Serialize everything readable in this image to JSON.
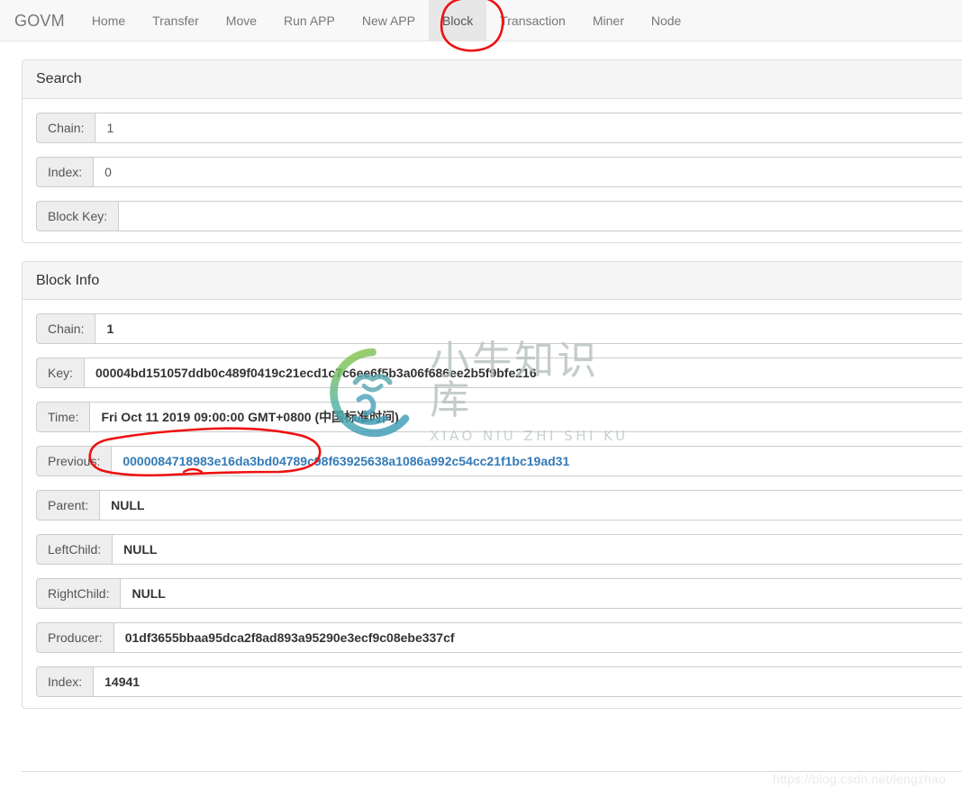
{
  "navbar": {
    "brand": "GOVM",
    "items": [
      {
        "label": "Home",
        "active": false
      },
      {
        "label": "Transfer",
        "active": false
      },
      {
        "label": "Move",
        "active": false
      },
      {
        "label": "Run APP",
        "active": false
      },
      {
        "label": "New APP",
        "active": false
      },
      {
        "label": "Block",
        "active": true
      },
      {
        "label": "Transaction",
        "active": false
      },
      {
        "label": "Miner",
        "active": false
      },
      {
        "label": "Node",
        "active": false
      }
    ]
  },
  "search_panel": {
    "title": "Search",
    "fields": [
      {
        "label": "Chain:",
        "value": "1",
        "placeholder": ""
      },
      {
        "label": "Index:",
        "value": "0",
        "placeholder": ""
      },
      {
        "label": "Block Key:",
        "value": "",
        "placeholder": ""
      }
    ]
  },
  "block_info_panel": {
    "title": "Block Info",
    "fields": [
      {
        "label": "Chain:",
        "value": "1",
        "style": "bold"
      },
      {
        "label": "Key:",
        "value": "00004bd151057ddb0c489f0419c21ecd1c7c6ee6f5b3a06f686ee2b5f9bfe216",
        "style": "bold"
      },
      {
        "label": "Time:",
        "value": "Fri Oct 11 2019 09:00:00 GMT+0800 (中国标准时间)",
        "style": "bold"
      },
      {
        "label": "Previous:",
        "value": "0000084718983e16da3bd04789c98f63925638a1086a992c54cc21f1bc19ad31",
        "style": "link"
      },
      {
        "label": "Parent:",
        "value": "NULL",
        "style": "bold"
      },
      {
        "label": "LeftChild:",
        "value": "NULL",
        "style": "bold"
      },
      {
        "label": "RightChild:",
        "value": "NULL",
        "style": "bold"
      },
      {
        "label": "Producer:",
        "value": "01df3655bbaa95dca2f8ad893a95290e3ecf9c08ebe337cf",
        "style": "bold"
      },
      {
        "label": "Index:",
        "value": "14941",
        "style": "bold"
      }
    ]
  },
  "watermark": {
    "chinese": "小牛知识库",
    "pinyin": "XIAO NIU ZHI SHI KU",
    "logo_color_start": "#8cc63f",
    "logo_color_end": "#3f9cb5"
  },
  "footer": {
    "url": "https://blog.csdn.net/lengzhao"
  },
  "annotations": {
    "color": "#ee1111",
    "block_tab_circle": "hand-drawn-circle-around-block-tab",
    "time_value_circle": "hand-drawn-circle-around-time-value"
  },
  "colors": {
    "navbar_bg": "#f8f8f8",
    "nav_active_bg": "#e7e7e7",
    "panel_border": "#dddddd",
    "panel_heading_bg": "#f5f5f5",
    "addon_bg": "#eeeeee",
    "link_blue": "#337ab7",
    "text": "#555555"
  }
}
